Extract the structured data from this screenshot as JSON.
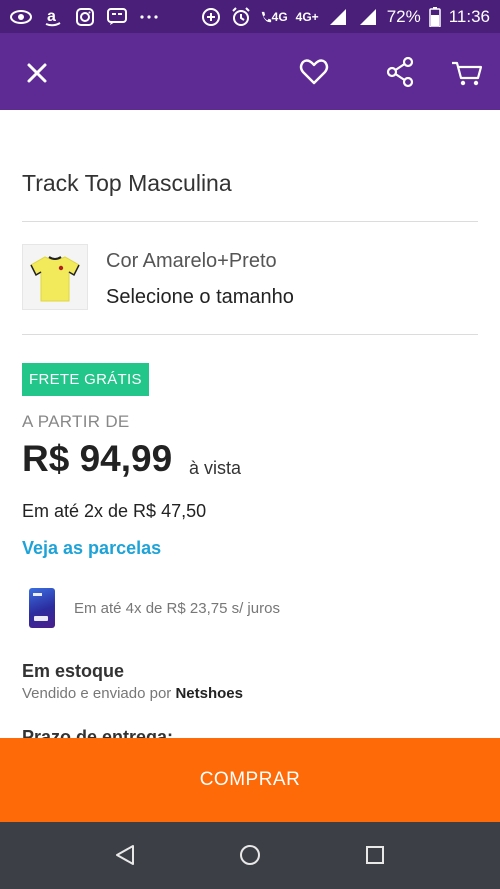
{
  "status_bar": {
    "battery": "72%",
    "time": "11:36",
    "network_4g": "4G",
    "network_4g_plus": "4G+",
    "icons": [
      "eye-icon",
      "amazon-a-icon",
      "instagram-icon",
      "chat-icon",
      "overflow-dots-icon",
      "data-saver-icon",
      "alarm-icon",
      "call-4g-icon",
      "signal-icon",
      "signal-icon",
      "battery-icon"
    ]
  },
  "app_bar": {
    "icons": [
      "close-icon",
      "heart-icon",
      "share-icon",
      "cart-icon"
    ],
    "bg_color": "#5e2a93"
  },
  "product": {
    "title": "Track Top Masculina",
    "color_label": "Cor Amarelo+Preto",
    "size_prompt": "Selecione o tamanho",
    "badge": "FRETE GRÁTIS",
    "from_label": "A PARTIR DE",
    "price": "R$ 94,99",
    "cash_label": "à vista",
    "installments": "Em até 2x de R$ 47,50",
    "installments_link": "Veja as parcelas",
    "card_offer": "Em até 4x de R$ 23,75 s/ juros",
    "stock": "Em estoque",
    "sold_by_prefix": "Vendido e enviado por",
    "seller": "Netshoes",
    "delivery": "Prazo de entrega:"
  },
  "buy_button": {
    "label": "COMPRAR",
    "color": "#ff6a08"
  },
  "nav_bar": {
    "icons": [
      "back-icon",
      "home-icon",
      "recent-apps-icon"
    ]
  }
}
